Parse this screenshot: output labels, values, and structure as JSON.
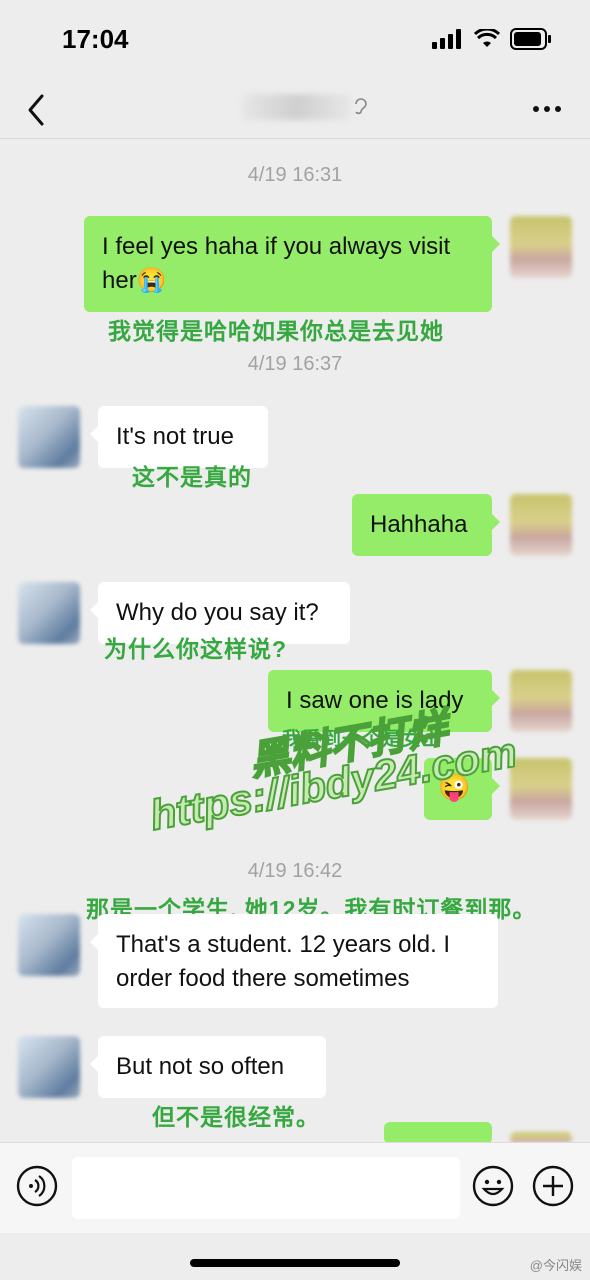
{
  "status": {
    "time": "17:04"
  },
  "chat": {
    "messages": [
      {
        "type": "timestamp",
        "text": "4/19 16:31"
      },
      {
        "type": "outgoing",
        "text_line1": "I feel yes haha if you always visit",
        "text_line2": "her😭"
      },
      {
        "type": "translation",
        "text": "我觉得是哈哈如果你总是去见她"
      },
      {
        "type": "timestamp",
        "text": "4/19 16:37"
      },
      {
        "type": "incoming",
        "text": "It's not true"
      },
      {
        "type": "translation",
        "text": "这不是真的"
      },
      {
        "type": "outgoing",
        "text": "Hahhaha"
      },
      {
        "type": "incoming",
        "text": "Why do you say it?"
      },
      {
        "type": "translation",
        "text": "为什么你这样说?"
      },
      {
        "type": "outgoing",
        "text": "I saw one is lady"
      },
      {
        "type": "translation",
        "text": "我看到一个是女士"
      },
      {
        "type": "outgoing",
        "text": "😜"
      },
      {
        "type": "timestamp",
        "text": "4/19 16:42"
      },
      {
        "type": "translation",
        "text": "那是一个学生, 她12岁。我有时订餐到那。"
      },
      {
        "type": "incoming",
        "text_line1": "That's a student. 12 years old. I",
        "text_line2": "order food there sometimes"
      },
      {
        "type": "incoming",
        "text": "But not so often"
      },
      {
        "type": "translation",
        "text": "但不是很经常。"
      }
    ]
  },
  "watermark": {
    "line1": "黑料不打烊",
    "line2": "https://ibdy24.com"
  },
  "input": {
    "placeholder": ""
  },
  "corner_mark": "@今闪娱",
  "colors": {
    "outgoing_bubble": "#95ec69",
    "incoming_bubble": "#ffffff",
    "translation_text": "#35a83f",
    "background": "#ededed"
  }
}
